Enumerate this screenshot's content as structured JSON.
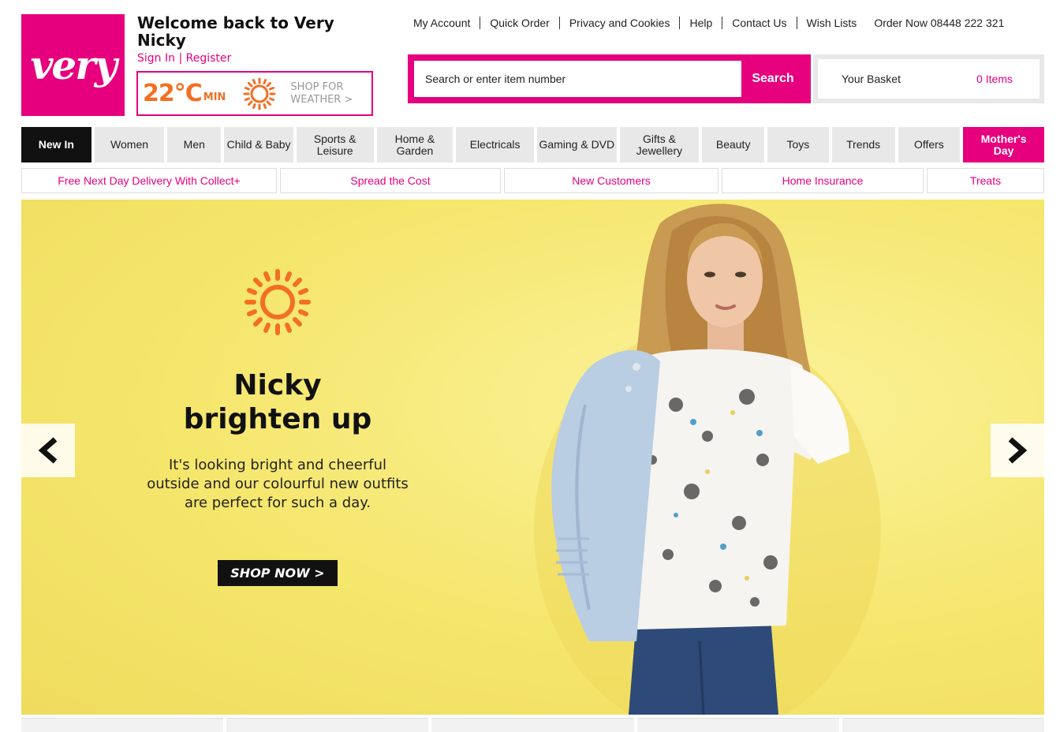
{
  "logo": {
    "text": "very"
  },
  "header": {
    "welcome": "Welcome back to Very Nicky",
    "sign_in": "Sign In",
    "separator": "|",
    "register": "Register"
  },
  "weather": {
    "temperature": "22°C",
    "min_label": "MIN",
    "cta_line1": "SHOP FOR",
    "cta_line2": "WEATHER >",
    "icon": "sun-icon",
    "color": "#f36f21"
  },
  "toplinks": {
    "my_account": "My Account",
    "quick_order": "Quick Order",
    "privacy": "Privacy and Cookies",
    "help": "Help",
    "contact": "Contact Us",
    "wish_lists": "Wish Lists",
    "order_now": "Order Now 08448 222 321"
  },
  "search": {
    "placeholder": "Search or enter item number",
    "button": "Search"
  },
  "basket": {
    "label": "Your Basket",
    "items": "0 Items"
  },
  "nav": {
    "items": [
      "New In",
      "Women",
      "Men",
      "Child & Baby",
      "Sports & Leisure",
      "Home & Garden",
      "Electricals",
      "Gaming & DVD",
      "Gifts & Jewellery",
      "Beauty",
      "Toys",
      "Trends",
      "Offers",
      "Mother's Day"
    ]
  },
  "subnav": {
    "items": [
      "Free Next Day Delivery With Collect+",
      "Spread the Cost",
      "New Customers",
      "Home Insurance",
      "Treats"
    ]
  },
  "hero": {
    "title_line1": "Nicky",
    "title_line2": "brighten up",
    "text_line1": "It's looking bright and cheerful",
    "text_line2": "outside and our colourful new outfits",
    "text_line3": "are perfect for such a day.",
    "button": "SHOP NOW >",
    "background_color": "#f6e97a"
  },
  "colors": {
    "brand": "#e6007e",
    "weather": "#f36f21",
    "nav_bg": "#e8e8e8"
  }
}
